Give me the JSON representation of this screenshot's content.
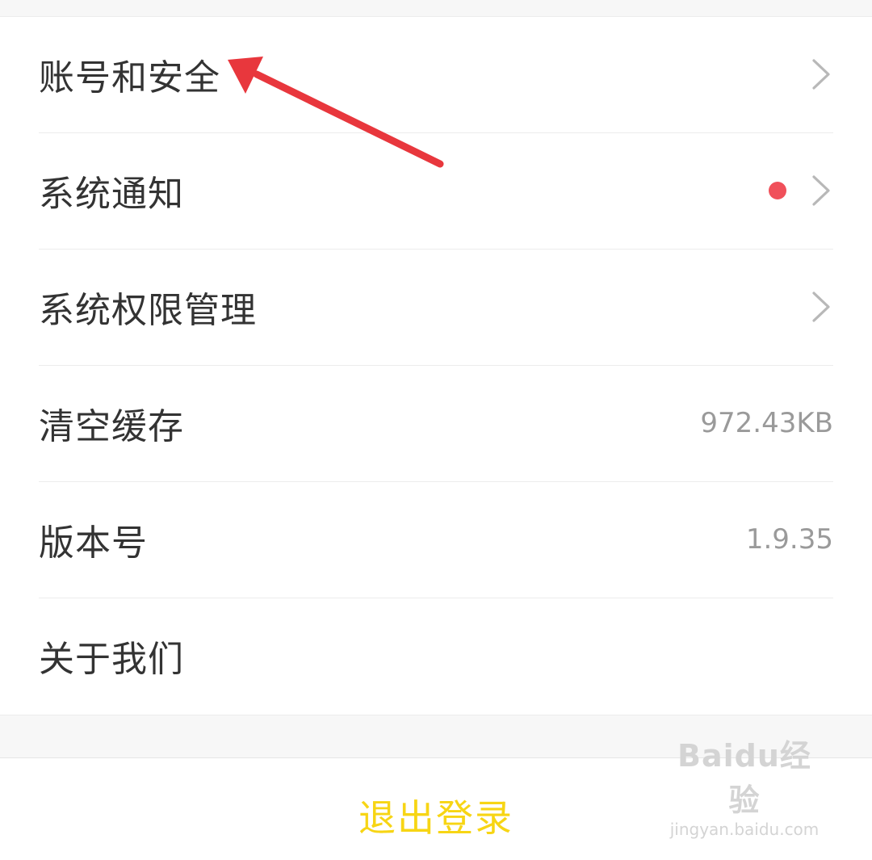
{
  "settings": {
    "items": [
      {
        "label": "账号和安全",
        "value": "",
        "badge": false,
        "chevron": true
      },
      {
        "label": "系统通知",
        "value": "",
        "badge": true,
        "chevron": true
      },
      {
        "label": "系统权限管理",
        "value": "",
        "badge": false,
        "chevron": true
      },
      {
        "label": "清空缓存",
        "value": "972.43KB",
        "badge": false,
        "chevron": false
      },
      {
        "label": "版本号",
        "value": "1.9.35",
        "badge": false,
        "chevron": false
      },
      {
        "label": "关于我们",
        "value": "",
        "badge": false,
        "chevron": false
      }
    ]
  },
  "logout": {
    "label": "退出登录"
  },
  "watermark": {
    "logo": "Baidu经验",
    "url": "jingyan.baidu.com"
  },
  "icons": {
    "chevron": "chevron-right-icon",
    "badge": "red-dot-badge",
    "annotation": "red-arrow"
  },
  "colors": {
    "accent_yellow": "#f7d514",
    "badge_red": "#f0505a",
    "annotation_red": "#e8373d",
    "chevron_gray": "#b8b8b8"
  }
}
